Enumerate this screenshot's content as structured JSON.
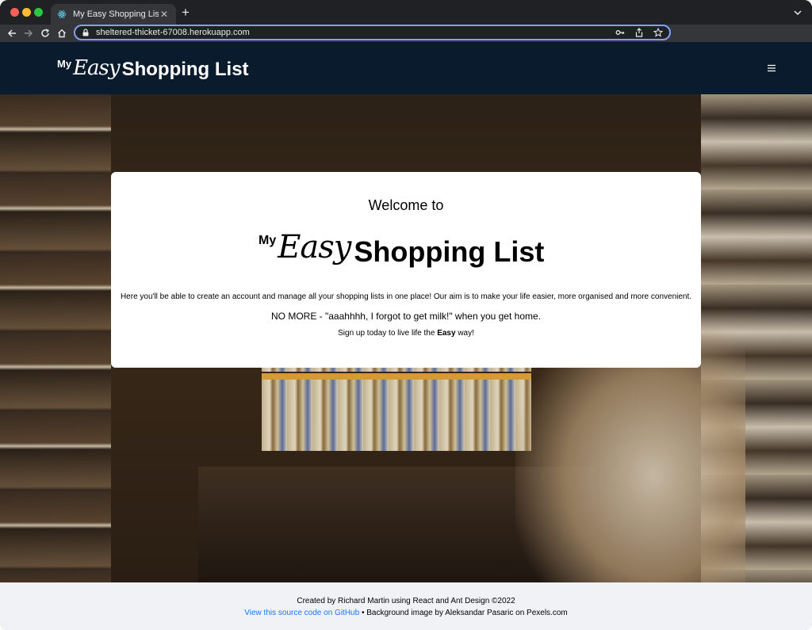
{
  "browser": {
    "tab_title": "My Easy Shopping List",
    "new_tab_label": "+",
    "url": "sheltered-thicket-67008.herokuapp.com"
  },
  "header": {
    "logo": {
      "my": "My",
      "easy": "Easy",
      "rest": "Shopping List"
    },
    "menu_icon": "hamburger-icon"
  },
  "hero": {
    "background_image": "Supermarket aisle background photo",
    "card": {
      "heading": "Welcome to",
      "logo": {
        "my": "My",
        "easy": "Easy",
        "rest": "Shopping List"
      },
      "intro": "Here you'll be able to create an account and manage all your shopping lists in one place! Our aim is to make your life easier, more organised and more convenient.",
      "no_more": "NO MORE - \"aaahhhh, I forgot to get milk!\" when you get home.",
      "signup_prefix": "Sign up today to live life the ",
      "signup_bold": "Easy",
      "signup_suffix": " way!"
    }
  },
  "footer": {
    "line1": "Created by Richard Martin using React and Ant Design ©2022",
    "link_text": "View this source code on GitHub",
    "line2_rest": " • Background image by Aleksandar Pasaric on Pexels.com"
  },
  "colors": {
    "header_bg": "#0a1b2e",
    "footer_bg": "#f0f2f5",
    "link": "#1677ff",
    "omnibox_focus": "#7ea2f6"
  }
}
